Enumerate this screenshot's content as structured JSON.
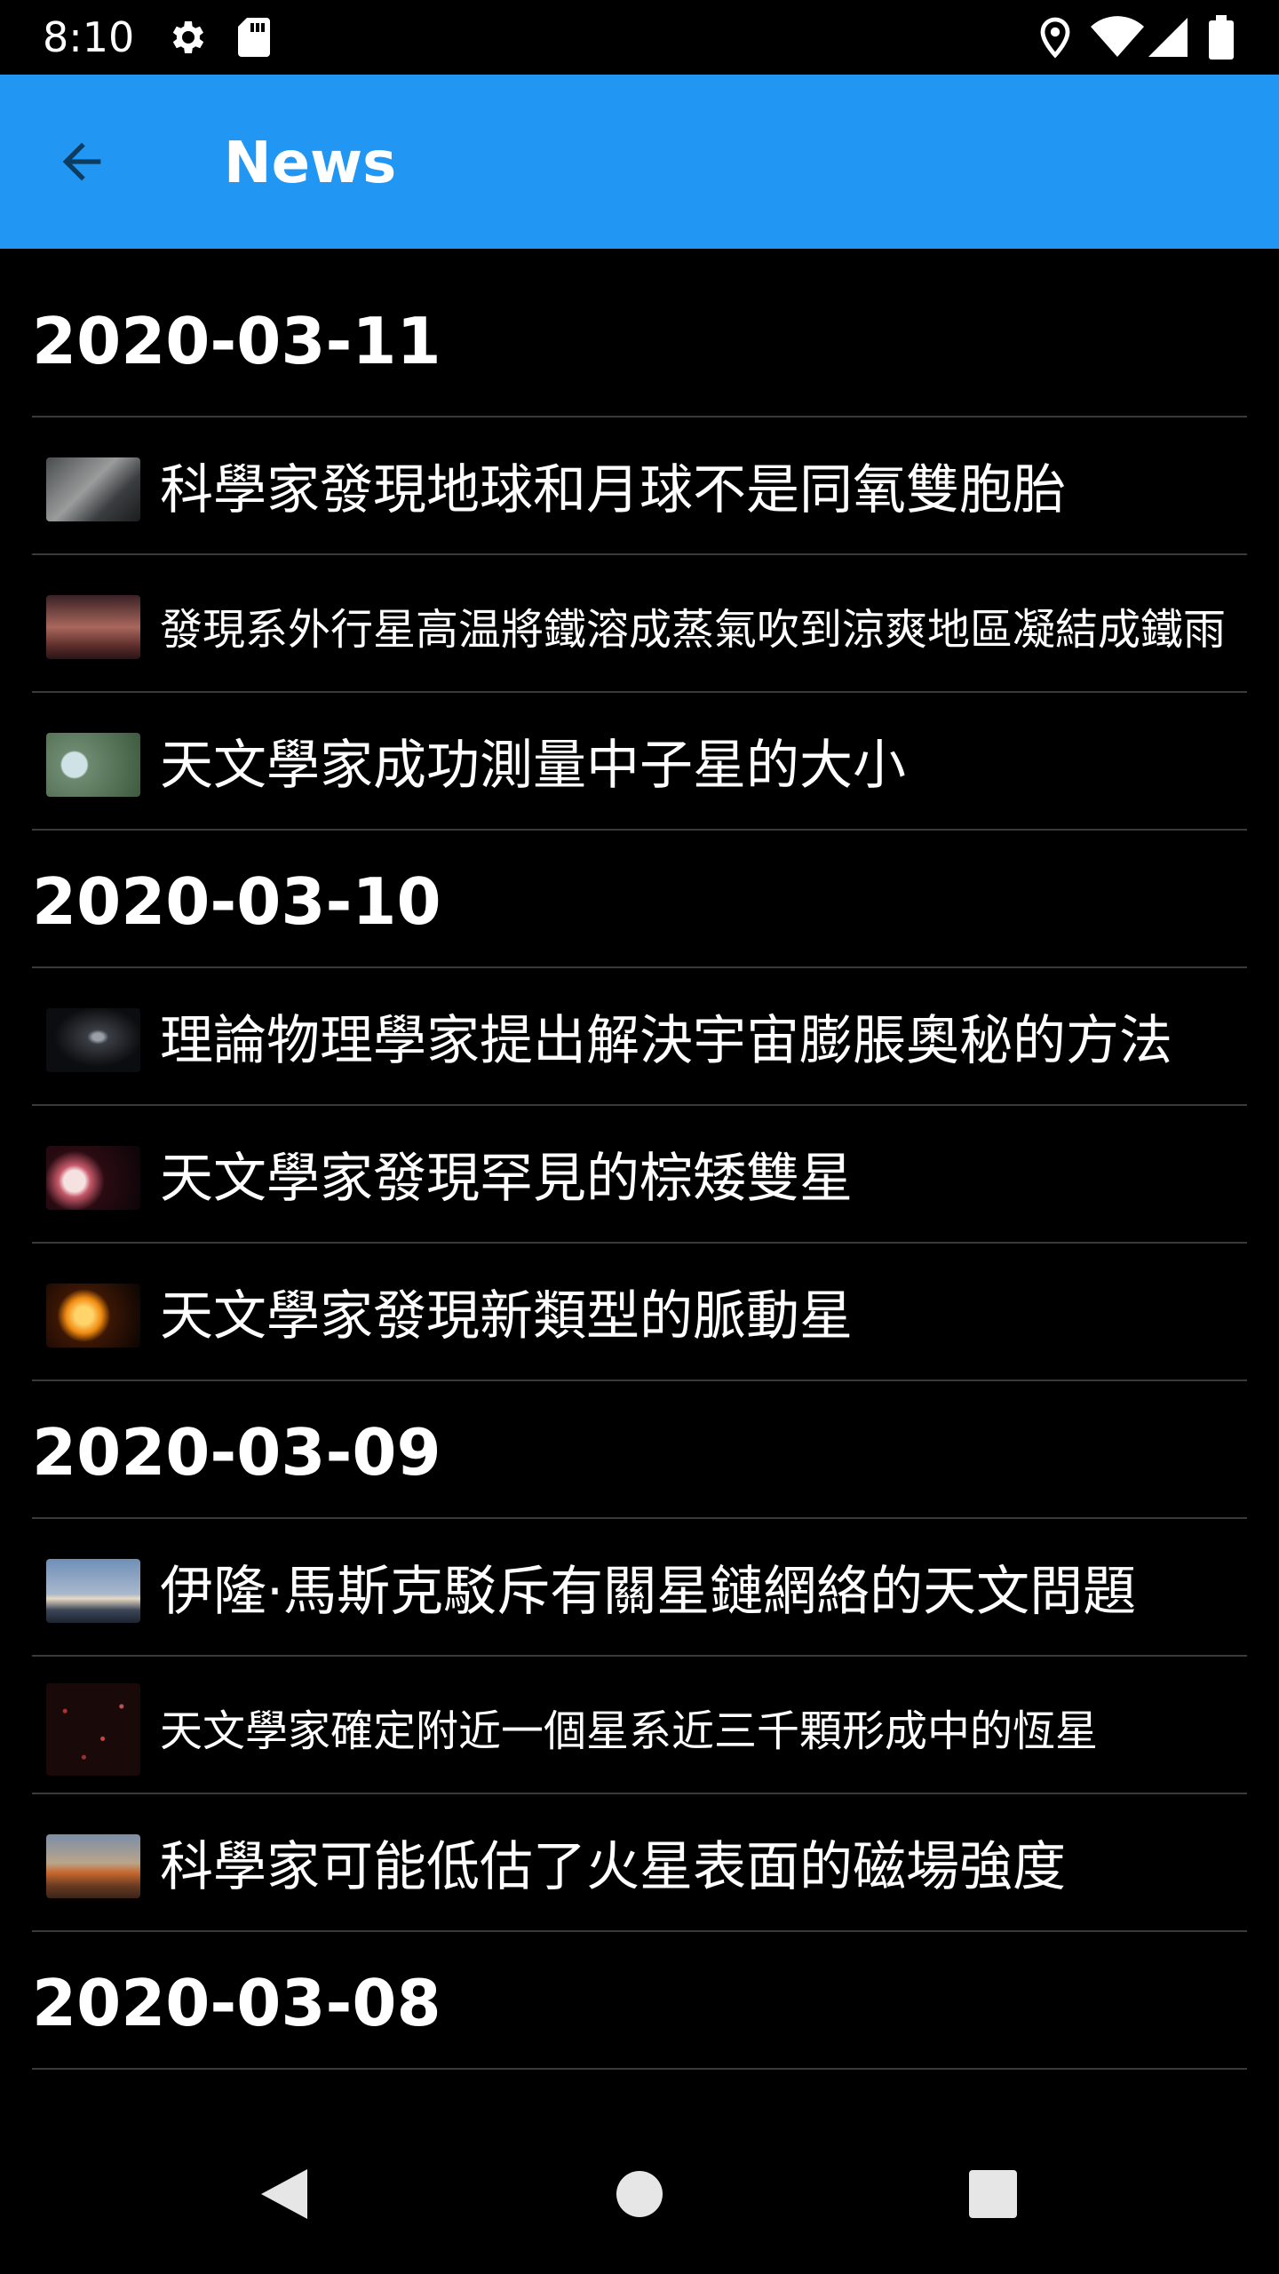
{
  "status_bar": {
    "time": "8:10",
    "icons": [
      "settings-icon",
      "sd-card-icon",
      "location-icon",
      "wifi-icon",
      "signal-icon",
      "battery-icon"
    ]
  },
  "app_bar": {
    "title": "News",
    "back_icon": "arrow-back-icon",
    "color": "#2196f3"
  },
  "sections": [
    {
      "date": "2020-03-11",
      "items": [
        {
          "title": "科學家發現地球和月球不是同氧雙胞胎",
          "thumb": "moon-earth"
        },
        {
          "title": "發現系外行星高温將鐵溶成蒸氣吹到涼爽地區凝結成鐵雨",
          "thumb": "exoplanet-red"
        },
        {
          "title": "天文學家成功測量中子星的大小",
          "thumb": "neutron-star"
        }
      ]
    },
    {
      "date": "2020-03-10",
      "items": [
        {
          "title": "理論物理學家提出解決宇宙膨脹奧秘的方法",
          "thumb": "galaxy"
        },
        {
          "title": "天文學家發現罕見的棕矮雙星",
          "thumb": "brown-dwarf"
        },
        {
          "title": "天文學家發現新類型的脈動星",
          "thumb": "pulsating-star"
        }
      ]
    },
    {
      "date": "2020-03-09",
      "items": [
        {
          "title": "伊隆·馬斯克駁斥有關星鏈網絡的天文問題",
          "thumb": "rocket-launch"
        },
        {
          "title": "天文學家確定附近一個星系近三千顆形成中的恆星",
          "thumb": "star-field"
        },
        {
          "title": "科學家可能低估了火星表面的磁場強度",
          "thumb": "mars-surface"
        }
      ]
    },
    {
      "date": "2020-03-08",
      "items": []
    }
  ],
  "nav_bar": {
    "icons": [
      "back-triangle-icon",
      "home-circle-icon",
      "recents-square-icon"
    ]
  }
}
